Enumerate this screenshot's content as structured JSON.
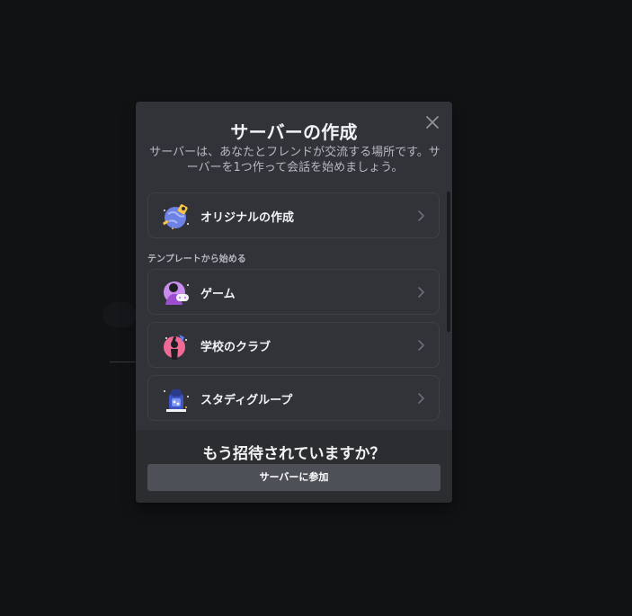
{
  "modal": {
    "title": "サーバーの作成",
    "subtitle": "サーバーは、あなたとフレンドが交流する場所です。サーバーを1つ作って会話を始めましょう。",
    "close_icon": "close-icon"
  },
  "options": {
    "create_own": {
      "label": "オリジナルの作成",
      "icon": "globe-rocket-icon"
    },
    "section_label": "テンプレートから始める",
    "templates": [
      {
        "label": "ゲーム",
        "icon": "gaming-controller-icon"
      },
      {
        "label": "学校のクラブ",
        "icon": "school-club-icon"
      },
      {
        "label": "スタディグループ",
        "icon": "study-group-icon"
      }
    ]
  },
  "footer": {
    "title": "もう招待されていますか？",
    "join_label": "サーバーに参加"
  },
  "colors": {
    "backdrop": "#111214",
    "modal_bg": "#313338",
    "footer_bg": "#2b2d31",
    "button_bg": "#4e5058",
    "text_primary": "#f2f3f5",
    "text_muted": "#b5bac1"
  }
}
